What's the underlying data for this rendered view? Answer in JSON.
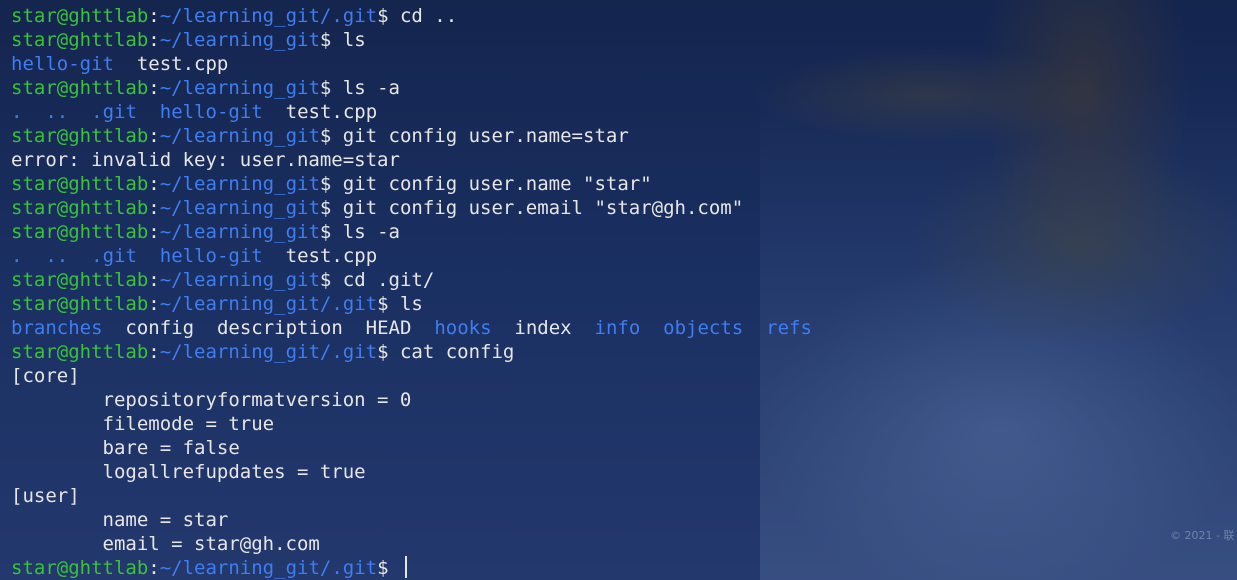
{
  "terminal": {
    "watermark": "© 2021 - 联",
    "lines": [
      {
        "kind": "prompt",
        "user": "star@ghttlab",
        "path": "~/learning_git/.git",
        "cmd": "cd .."
      },
      {
        "kind": "prompt",
        "user": "star@ghttlab",
        "path": "~/learning_git",
        "cmd": "ls"
      },
      {
        "kind": "ls",
        "items": [
          {
            "t": "hello-git",
            "dir": true
          },
          {
            "t": "test.cpp",
            "dir": false
          }
        ]
      },
      {
        "kind": "prompt",
        "user": "star@ghttlab",
        "path": "~/learning_git",
        "cmd": "ls -a"
      },
      {
        "kind": "ls",
        "items": [
          {
            "t": ".",
            "dir": true
          },
          {
            "t": "..",
            "dir": true
          },
          {
            "t": ".git",
            "dir": true
          },
          {
            "t": "hello-git",
            "dir": true
          },
          {
            "t": "test.cpp",
            "dir": false
          }
        ]
      },
      {
        "kind": "prompt",
        "user": "star@ghttlab",
        "path": "~/learning_git",
        "cmd": "git config user.name=star"
      },
      {
        "kind": "text",
        "text": "error: invalid key: user.name=star"
      },
      {
        "kind": "prompt",
        "user": "star@ghttlab",
        "path": "~/learning_git",
        "cmd": "git config user.name \"star\""
      },
      {
        "kind": "prompt",
        "user": "star@ghttlab",
        "path": "~/learning_git",
        "cmd": "git config user.email \"star@gh.com\""
      },
      {
        "kind": "prompt",
        "user": "star@ghttlab",
        "path": "~/learning_git",
        "cmd": "ls -a"
      },
      {
        "kind": "ls",
        "items": [
          {
            "t": ".",
            "dir": true
          },
          {
            "t": "..",
            "dir": true
          },
          {
            "t": ".git",
            "dir": true
          },
          {
            "t": "hello-git",
            "dir": true
          },
          {
            "t": "test.cpp",
            "dir": false
          }
        ]
      },
      {
        "kind": "prompt",
        "user": "star@ghttlab",
        "path": "~/learning_git",
        "cmd": "cd .git/"
      },
      {
        "kind": "prompt",
        "user": "star@ghttlab",
        "path": "~/learning_git/.git",
        "cmd": "ls"
      },
      {
        "kind": "ls",
        "items": [
          {
            "t": "branches",
            "dir": true
          },
          {
            "t": "config",
            "dir": false
          },
          {
            "t": "description",
            "dir": false
          },
          {
            "t": "HEAD",
            "dir": false
          },
          {
            "t": "hooks",
            "dir": true
          },
          {
            "t": "index",
            "dir": false
          },
          {
            "t": "info",
            "dir": true
          },
          {
            "t": "objects",
            "dir": true
          },
          {
            "t": "refs",
            "dir": true
          }
        ]
      },
      {
        "kind": "prompt",
        "user": "star@ghttlab",
        "path": "~/learning_git/.git",
        "cmd": "cat config"
      },
      {
        "kind": "text",
        "text": "[core]"
      },
      {
        "kind": "text",
        "text": "        repositoryformatversion = 0"
      },
      {
        "kind": "text",
        "text": "        filemode = true"
      },
      {
        "kind": "text",
        "text": "        bare = false"
      },
      {
        "kind": "text",
        "text": "        logallrefupdates = true"
      },
      {
        "kind": "text",
        "text": "[user]"
      },
      {
        "kind": "text",
        "text": "        name = star"
      },
      {
        "kind": "text",
        "text": "        email = star@gh.com"
      },
      {
        "kind": "prompt",
        "user": "star@ghttlab",
        "path": "~/learning_git/.git",
        "cmd": "",
        "cursor": true
      }
    ]
  },
  "colors": {
    "prompt_user": "#39c23a",
    "prompt_path": "#3f7df0",
    "directory": "#3f7df0",
    "text": "#e6e6e6",
    "background": "#1a2f61"
  }
}
